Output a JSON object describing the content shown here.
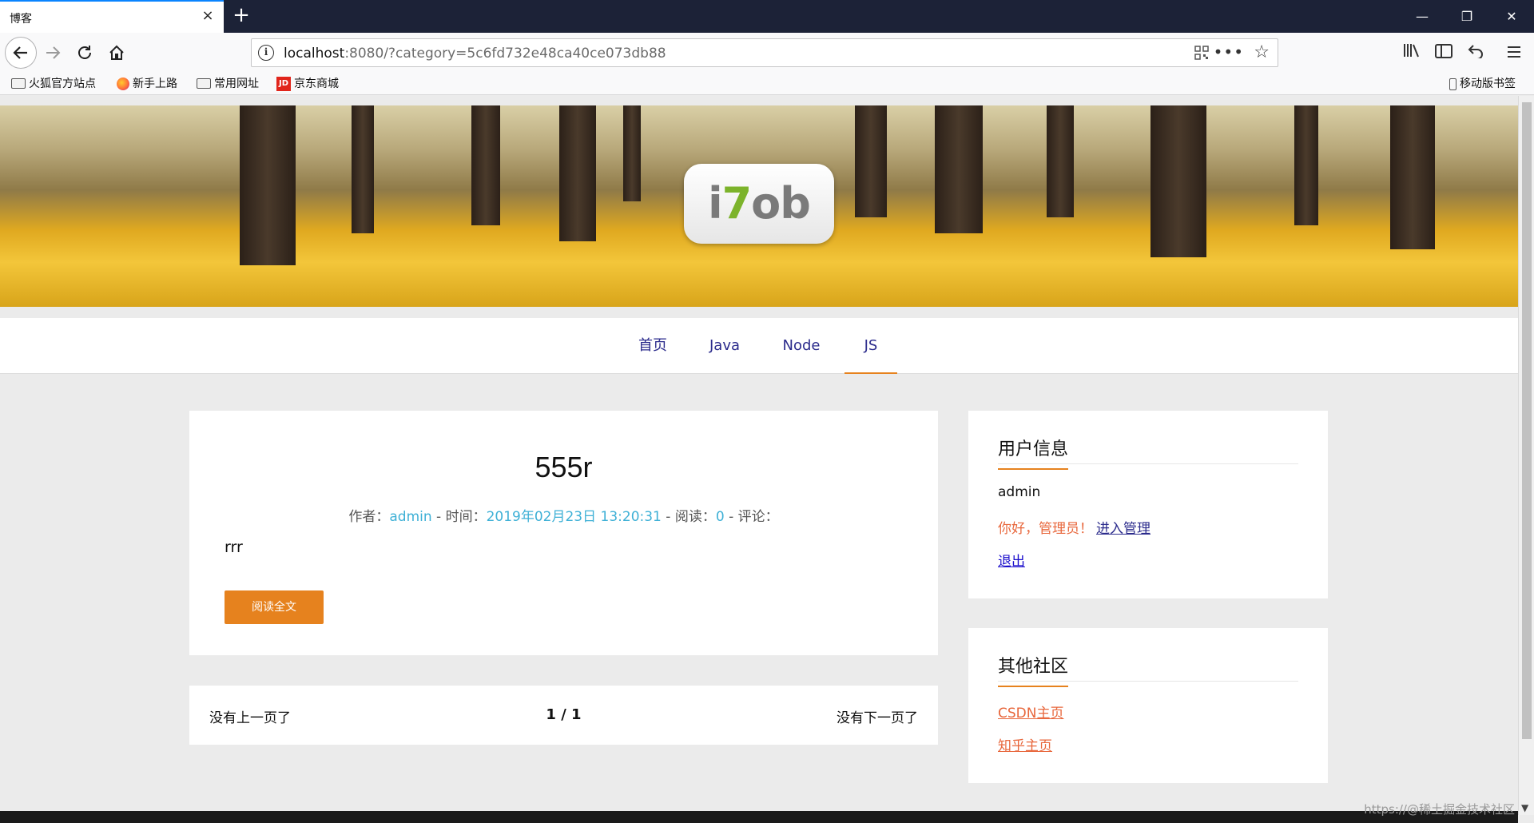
{
  "browser": {
    "tab_title": "博客",
    "tab_close": "×",
    "new_tab": "+",
    "url_host": "localhost",
    "url_rest": ":8080/?category=5c6fd732e48ca40ce073db88",
    "more": "•••",
    "star": "☆",
    "win_min": "—",
    "win_max": "❐",
    "win_close": "✕",
    "bookmarks": [
      {
        "label": "火狐官方站点",
        "icon": "folder-icon"
      },
      {
        "label": "新手上路",
        "icon": "firefox-icon"
      },
      {
        "label": "常用网址",
        "icon": "folder-icon"
      },
      {
        "label": "京东商城",
        "icon": "jd-icon",
        "icon_text": "JD"
      }
    ],
    "mobile_bookmarks": "移动版书签"
  },
  "site": {
    "logo": {
      "left": "i",
      "mid": "7",
      "right": "ob"
    },
    "nav": [
      "首页",
      "Java",
      "Node",
      "JS"
    ],
    "active_nav": "JS",
    "accent": "#e6821e",
    "link_color": "#3eb0d6"
  },
  "post": {
    "title": "555r",
    "author_label": "作者：",
    "author": "admin",
    "time_label": " - 时间：",
    "time": "2019年02月23日 13:20:31",
    "read_label": " - 阅读：",
    "reads": "0",
    "comment_label": " - 评论：",
    "body": "rrr",
    "read_more": "阅读全文"
  },
  "pager": {
    "prev": "没有上一页了",
    "page": "1 / 1",
    "next": "没有下一页了"
  },
  "user_panel": {
    "title": "用户信息",
    "username": "admin",
    "greeting": "你好，管理员！",
    "admin_link": "进入管理",
    "logout": "退出"
  },
  "community_panel": {
    "title": "其他社区",
    "links": [
      "CSDN主页",
      "知乎主页"
    ]
  },
  "watermark": "https://@稀土掘金技术社区"
}
